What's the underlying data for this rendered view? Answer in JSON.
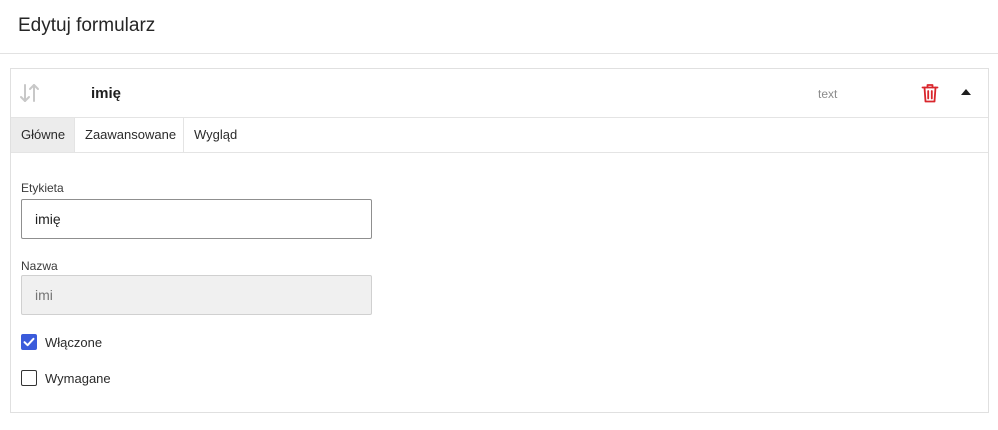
{
  "header": {
    "title": "Edytuj formularz"
  },
  "field": {
    "name": "imię",
    "type": "text",
    "icons": {
      "drag": "sort-arrows-icon",
      "delete": "trash-icon",
      "collapse": "caret-up-icon"
    },
    "colors": {
      "delete": "#d9262c",
      "checkbox_accent": "#3b5bdb"
    }
  },
  "tabs": [
    {
      "label": "Główne",
      "active": true
    },
    {
      "label": "Zaawansowane",
      "active": false
    },
    {
      "label": "Wygląd",
      "active": false
    }
  ],
  "form": {
    "label_field": {
      "label": "Etykieta",
      "value": "imię"
    },
    "name_field": {
      "label": "Nazwa",
      "placeholder": "imi",
      "disabled": true
    },
    "enabled": {
      "label": "Włączone",
      "checked": true
    },
    "required": {
      "label": "Wymagane",
      "checked": false
    }
  }
}
